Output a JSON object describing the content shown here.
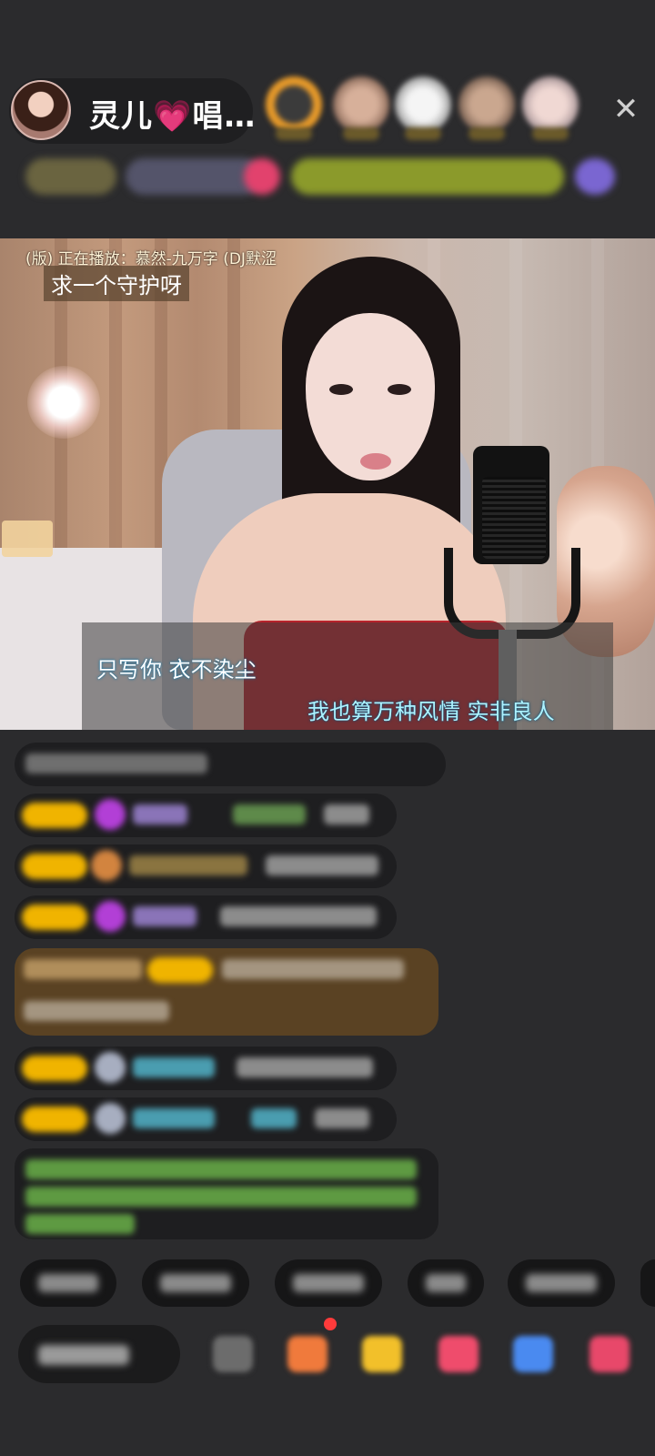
{
  "host": {
    "name": "灵儿💗唱…"
  },
  "video": {
    "now_playing": "(版) 正在播放：慕然-九万字 (DJ默涩",
    "guard_request": "求一个守护呀",
    "lyric_line1": "只写你  衣不染尘",
    "lyric_line2": "我也算万种风情  实非良人"
  },
  "controls": {
    "close_icon": "close-icon",
    "close_glyph": "✕"
  },
  "colors": {
    "background": "#2b2b2d",
    "badge_yellow": "#f0b400",
    "dress_red": "#b7232b",
    "lyric_cyan": "#aef3ff"
  }
}
